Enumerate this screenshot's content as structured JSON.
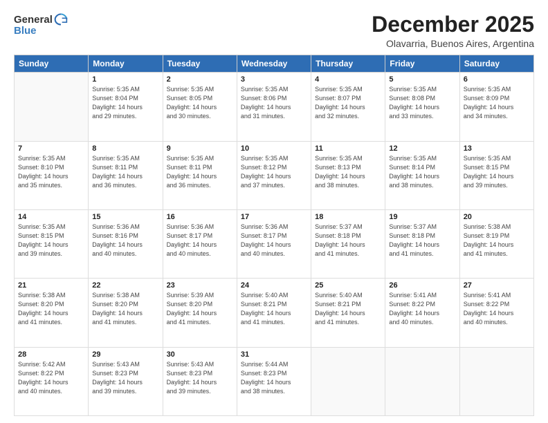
{
  "header": {
    "logo_general": "General",
    "logo_blue": "Blue",
    "title": "December 2025",
    "subtitle": "Olavarria, Buenos Aires, Argentina"
  },
  "days_of_week": [
    "Sunday",
    "Monday",
    "Tuesday",
    "Wednesday",
    "Thursday",
    "Friday",
    "Saturday"
  ],
  "weeks": [
    [
      {
        "day": "",
        "info": ""
      },
      {
        "day": "1",
        "info": "Sunrise: 5:35 AM\nSunset: 8:04 PM\nDaylight: 14 hours\nand 29 minutes."
      },
      {
        "day": "2",
        "info": "Sunrise: 5:35 AM\nSunset: 8:05 PM\nDaylight: 14 hours\nand 30 minutes."
      },
      {
        "day": "3",
        "info": "Sunrise: 5:35 AM\nSunset: 8:06 PM\nDaylight: 14 hours\nand 31 minutes."
      },
      {
        "day": "4",
        "info": "Sunrise: 5:35 AM\nSunset: 8:07 PM\nDaylight: 14 hours\nand 32 minutes."
      },
      {
        "day": "5",
        "info": "Sunrise: 5:35 AM\nSunset: 8:08 PM\nDaylight: 14 hours\nand 33 minutes."
      },
      {
        "day": "6",
        "info": "Sunrise: 5:35 AM\nSunset: 8:09 PM\nDaylight: 14 hours\nand 34 minutes."
      }
    ],
    [
      {
        "day": "7",
        "info": "Sunrise: 5:35 AM\nSunset: 8:10 PM\nDaylight: 14 hours\nand 35 minutes."
      },
      {
        "day": "8",
        "info": "Sunrise: 5:35 AM\nSunset: 8:11 PM\nDaylight: 14 hours\nand 36 minutes."
      },
      {
        "day": "9",
        "info": "Sunrise: 5:35 AM\nSunset: 8:11 PM\nDaylight: 14 hours\nand 36 minutes."
      },
      {
        "day": "10",
        "info": "Sunrise: 5:35 AM\nSunset: 8:12 PM\nDaylight: 14 hours\nand 37 minutes."
      },
      {
        "day": "11",
        "info": "Sunrise: 5:35 AM\nSunset: 8:13 PM\nDaylight: 14 hours\nand 38 minutes."
      },
      {
        "day": "12",
        "info": "Sunrise: 5:35 AM\nSunset: 8:14 PM\nDaylight: 14 hours\nand 38 minutes."
      },
      {
        "day": "13",
        "info": "Sunrise: 5:35 AM\nSunset: 8:15 PM\nDaylight: 14 hours\nand 39 minutes."
      }
    ],
    [
      {
        "day": "14",
        "info": "Sunrise: 5:35 AM\nSunset: 8:15 PM\nDaylight: 14 hours\nand 39 minutes."
      },
      {
        "day": "15",
        "info": "Sunrise: 5:36 AM\nSunset: 8:16 PM\nDaylight: 14 hours\nand 40 minutes."
      },
      {
        "day": "16",
        "info": "Sunrise: 5:36 AM\nSunset: 8:17 PM\nDaylight: 14 hours\nand 40 minutes."
      },
      {
        "day": "17",
        "info": "Sunrise: 5:36 AM\nSunset: 8:17 PM\nDaylight: 14 hours\nand 40 minutes."
      },
      {
        "day": "18",
        "info": "Sunrise: 5:37 AM\nSunset: 8:18 PM\nDaylight: 14 hours\nand 41 minutes."
      },
      {
        "day": "19",
        "info": "Sunrise: 5:37 AM\nSunset: 8:18 PM\nDaylight: 14 hours\nand 41 minutes."
      },
      {
        "day": "20",
        "info": "Sunrise: 5:38 AM\nSunset: 8:19 PM\nDaylight: 14 hours\nand 41 minutes."
      }
    ],
    [
      {
        "day": "21",
        "info": "Sunrise: 5:38 AM\nSunset: 8:20 PM\nDaylight: 14 hours\nand 41 minutes."
      },
      {
        "day": "22",
        "info": "Sunrise: 5:38 AM\nSunset: 8:20 PM\nDaylight: 14 hours\nand 41 minutes."
      },
      {
        "day": "23",
        "info": "Sunrise: 5:39 AM\nSunset: 8:20 PM\nDaylight: 14 hours\nand 41 minutes."
      },
      {
        "day": "24",
        "info": "Sunrise: 5:40 AM\nSunset: 8:21 PM\nDaylight: 14 hours\nand 41 minutes."
      },
      {
        "day": "25",
        "info": "Sunrise: 5:40 AM\nSunset: 8:21 PM\nDaylight: 14 hours\nand 41 minutes."
      },
      {
        "day": "26",
        "info": "Sunrise: 5:41 AM\nSunset: 8:22 PM\nDaylight: 14 hours\nand 40 minutes."
      },
      {
        "day": "27",
        "info": "Sunrise: 5:41 AM\nSunset: 8:22 PM\nDaylight: 14 hours\nand 40 minutes."
      }
    ],
    [
      {
        "day": "28",
        "info": "Sunrise: 5:42 AM\nSunset: 8:22 PM\nDaylight: 14 hours\nand 40 minutes."
      },
      {
        "day": "29",
        "info": "Sunrise: 5:43 AM\nSunset: 8:23 PM\nDaylight: 14 hours\nand 39 minutes."
      },
      {
        "day": "30",
        "info": "Sunrise: 5:43 AM\nSunset: 8:23 PM\nDaylight: 14 hours\nand 39 minutes."
      },
      {
        "day": "31",
        "info": "Sunrise: 5:44 AM\nSunset: 8:23 PM\nDaylight: 14 hours\nand 38 minutes."
      },
      {
        "day": "",
        "info": ""
      },
      {
        "day": "",
        "info": ""
      },
      {
        "day": "",
        "info": ""
      }
    ]
  ]
}
